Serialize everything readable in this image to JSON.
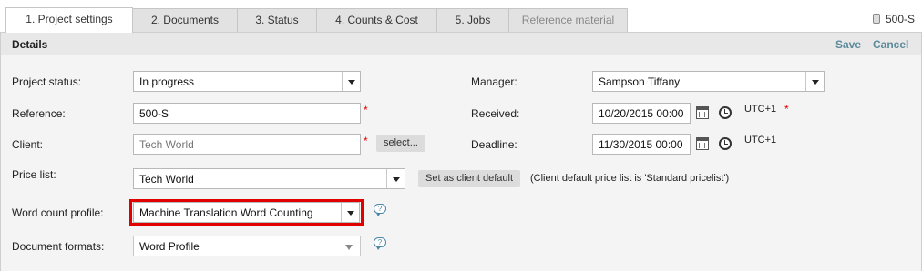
{
  "tabs": [
    {
      "label": "1. Project settings",
      "state": "active"
    },
    {
      "label": "2. Documents",
      "state": "normal"
    },
    {
      "label": "3. Status",
      "state": "normal"
    },
    {
      "label": "4. Counts & Cost",
      "state": "normal"
    },
    {
      "label": "5. Jobs",
      "state": "normal"
    },
    {
      "label": "Reference material",
      "state": "disabled"
    }
  ],
  "project_id": "500-S",
  "panel": {
    "title": "Details",
    "save_label": "Save",
    "cancel_label": "Cancel"
  },
  "form": {
    "project_status": {
      "label": "Project status:",
      "value": "In progress"
    },
    "reference": {
      "label": "Reference:",
      "value": "500-S",
      "required": "*"
    },
    "client": {
      "label": "Client:",
      "placeholder": "Tech World",
      "required": "*",
      "select_button": "select..."
    },
    "price_list": {
      "label": "Price list:",
      "value": "Tech World",
      "client_default_button": "Set as client default",
      "note": "(Client default price list is 'Standard pricelist')"
    },
    "word_count_profile": {
      "label": "Word count profile:",
      "value": "Machine Translation Word Counting"
    },
    "document_formats": {
      "label": "Document formats:",
      "value": "Word Profile"
    },
    "manager": {
      "label": "Manager:",
      "value": "Sampson Tiffany"
    },
    "received": {
      "label": "Received:",
      "value": "10/20/2015 00:00",
      "timezone": "UTC+1",
      "required": "*"
    },
    "deadline": {
      "label": "Deadline:",
      "value": "11/30/2015 00:00",
      "timezone": "UTC+1"
    }
  },
  "help_icon_glyph": "?",
  "highlight_color": "#e00000",
  "link_color": "#5b8a9a"
}
